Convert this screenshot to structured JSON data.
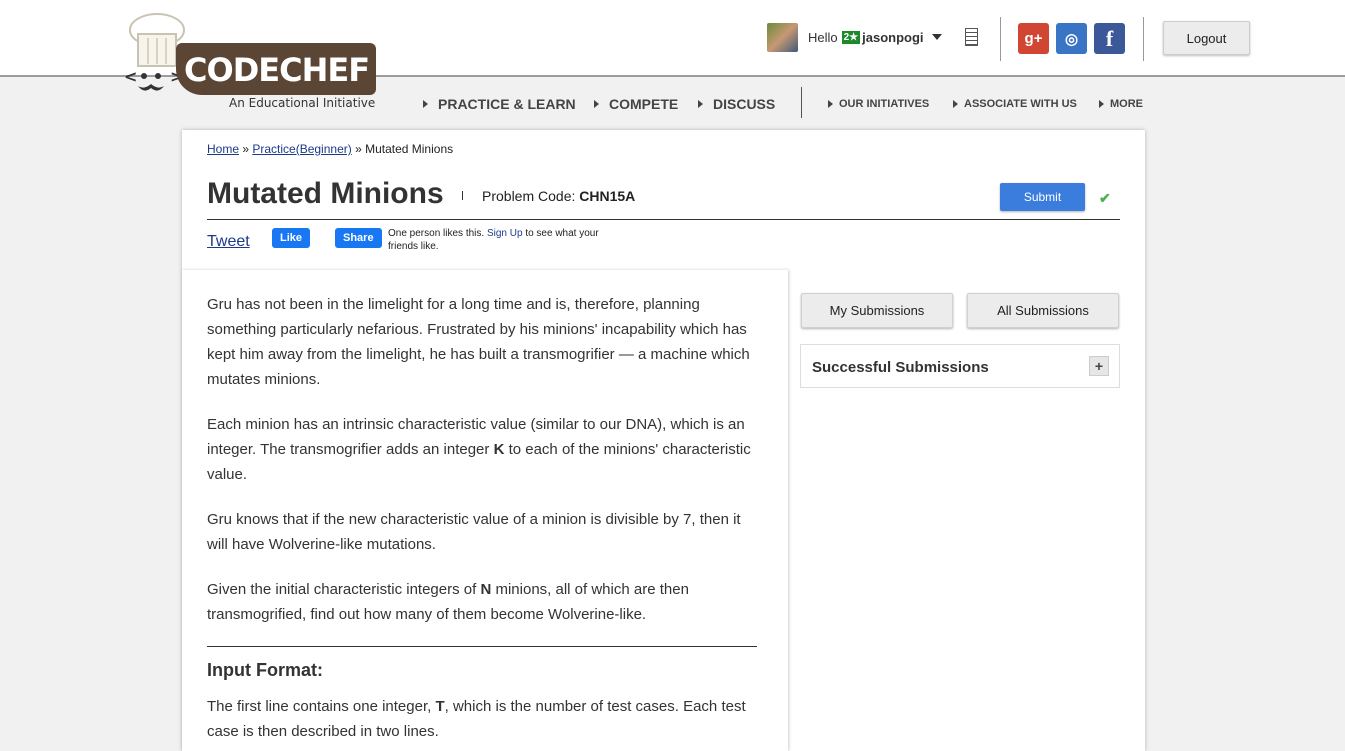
{
  "header": {
    "logo_text": "CODECHEF",
    "tagline": "An Educational Initiative",
    "greeting": "Hello",
    "rating_badge": "2★",
    "username": "jasonpogi",
    "logout_label": "Logout",
    "social": {
      "gplus": "g+",
      "github": "◎",
      "facebook": "f"
    }
  },
  "nav": {
    "primary": [
      "PRACTICE & LEARN",
      "COMPETE",
      "DISCUSS"
    ],
    "secondary": [
      "OUR INITIATIVES",
      "ASSOCIATE WITH US",
      "MORE"
    ]
  },
  "breadcrumb": {
    "home": "Home",
    "sep1": " » ",
    "practice": "Practice(Beginner)",
    "sep2": " » ",
    "current": "Mutated Minions"
  },
  "problem": {
    "title": "Mutated Minions",
    "code_label": "Problem Code:",
    "code": "CHN15A",
    "submit_label": "Submit",
    "check": "✔"
  },
  "share": {
    "tweet": "Tweet",
    "like": "Like",
    "share": "Share",
    "likes_text": "One person likes this.",
    "signup": "Sign Up",
    "likes_suffix": "to see what your friends like."
  },
  "statement": {
    "p1": "Gru has not been in the limelight for a long time and is, therefore, planning something particularly nefarious. Frustrated by his minions' incapability which has kept him away from the limelight, he has built a transmogrifier — a machine which mutates minions.",
    "p2a": "Each minion has an intrinsic characteristic value (similar to our DNA), which is an integer. The transmogrifier adds an integer ",
    "p2k": "K",
    "p2b": " to each of the minions' characteristic value.",
    "p3": "Gru knows that if the new characteristic value of a minion is divisible by 7, then it will have Wolverine-like mutations.",
    "p4a": "Given the initial characteristic integers of ",
    "p4n": "N",
    "p4b": " minions, all of which are then transmogrified, find out how many of them become Wolverine-like.",
    "input_heading": "Input Format:",
    "p5a": "The first line contains one integer, ",
    "p5t": "T",
    "p5b": ", which is the number of test cases. Each test case is then described in two lines."
  },
  "sidebar": {
    "my_submissions": "My Submissions",
    "all_submissions": "All Submissions",
    "successful_title": "Successful Submissions",
    "expand": "+"
  }
}
